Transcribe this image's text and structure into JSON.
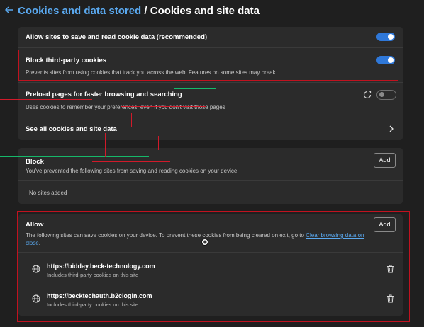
{
  "header": {
    "breadcrumb_parent": "Cookies and data stored",
    "separator": " / ",
    "title": "Cookies and site data"
  },
  "settings": {
    "allow_sites": {
      "label": "Allow sites to save and read cookie data (recommended)",
      "enabled": true
    },
    "block_third_party": {
      "label": "Block third-party cookies",
      "description": "Prevents sites from using cookies that track you across the web. Features on some sites may break.",
      "enabled": true
    },
    "preload": {
      "label": "Preload pages for faster browsing and searching",
      "description": "Uses cookies to remember your preferences, even if you don't visit those pages",
      "enabled": false
    },
    "see_all": {
      "label": "See all cookies and site data"
    }
  },
  "block_section": {
    "title": "Block",
    "description": "You've prevented the following sites from saving and reading cookies on your device.",
    "add_label": "Add",
    "empty_text": "No sites added"
  },
  "allow_section": {
    "title": "Allow",
    "description_line1": "The following sites can save cookies on your device. To prevent these cookies from being cleared on exit, go to",
    "link_part1": "Clear browsing data on",
    "link_part2": "close",
    "description_end": ".",
    "add_label": "Add",
    "sites": [
      {
        "url": "https://bidday.beck-technology.com",
        "detail": "Includes third-party cookies on this site"
      },
      {
        "url": "https://becktechauth.b2clogin.com",
        "detail": "Includes third-party cookies on this site"
      }
    ]
  },
  "colors": {
    "accent": "#2f78d9",
    "link": "#5aa9f0",
    "highlight_border": "#c1121f",
    "background": "#1f1f1f",
    "card": "#2b2b2b"
  },
  "icons": [
    "back-arrow-icon",
    "preload-icon",
    "chevron-right-icon",
    "globe-icon",
    "trash-icon",
    "cursor-icon"
  ]
}
